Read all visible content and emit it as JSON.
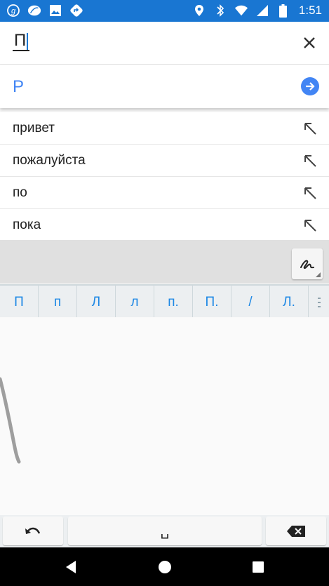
{
  "status_bar": {
    "left_icons": [
      "g-app-icon",
      "leaf-app-icon",
      "image-icon",
      "maps-nav-icon"
    ],
    "right_icons": [
      "location-icon",
      "bluetooth-icon",
      "wifi-icon",
      "signal-icon",
      "battery-icon"
    ],
    "time": "1:51"
  },
  "search": {
    "input_value": "П",
    "clear_icon": "close-icon"
  },
  "translation": {
    "text": "P",
    "go_icon": "arrow-forward-icon"
  },
  "suggestions": [
    {
      "label": "привет"
    },
    {
      "label": "пожалуйста"
    },
    {
      "label": "по"
    },
    {
      "label": "пока"
    }
  ],
  "candidates": [
    "П",
    "п",
    "Л",
    "л",
    "п.",
    "П.",
    "/",
    "Л."
  ],
  "keyboard": {
    "undo_icon": "undo-icon",
    "space_label": "␣",
    "delete_icon": "backspace-icon"
  },
  "colors": {
    "status_bar": "#1976d2",
    "accent": "#4285f4",
    "candidate_text": "#1e88e5"
  }
}
